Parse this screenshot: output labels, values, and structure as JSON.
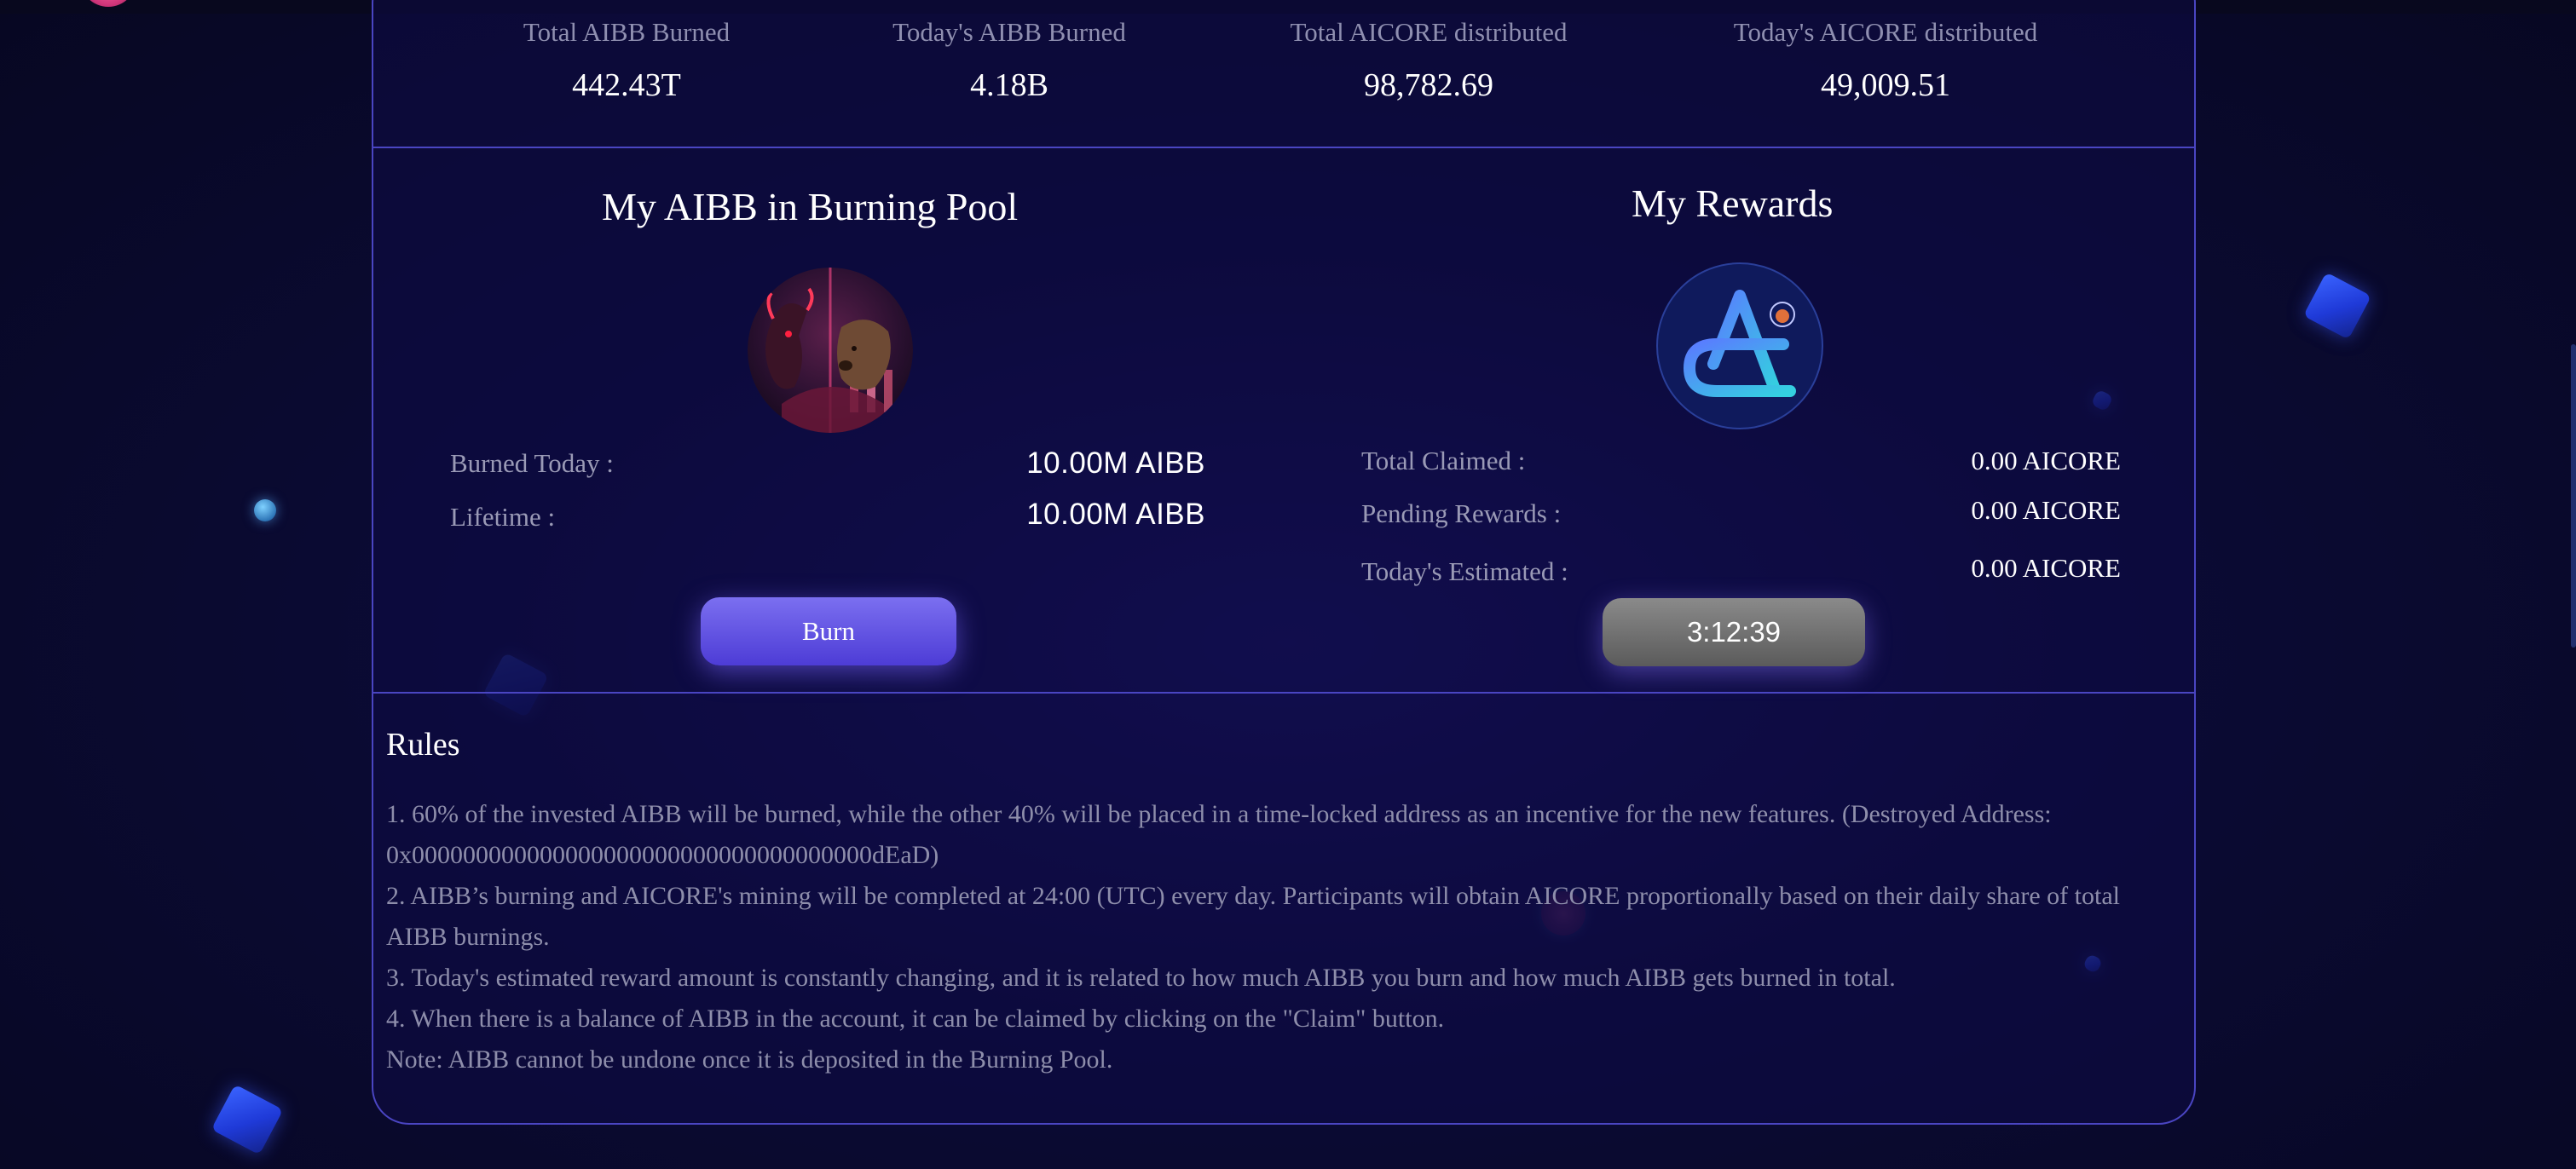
{
  "stats": [
    {
      "label": "Total AIBB Burned",
      "value": "442.43T"
    },
    {
      "label": "Today's AIBB Burned",
      "value": "4.18B"
    },
    {
      "label": "Total AICORE distributed",
      "value": "98,782.69"
    },
    {
      "label": "Today's AICORE distributed",
      "value": "49,009.51"
    }
  ],
  "pool": {
    "title": "My AIBB in Burning Pool",
    "rows": [
      {
        "label": "Burned Today :",
        "value": "10.00M AIBB"
      },
      {
        "label": "Lifetime :",
        "value": "10.00M AIBB"
      }
    ],
    "burn_label": "Burn"
  },
  "rewards": {
    "title": "My Rewards",
    "rows": [
      {
        "label": "Total Claimed :",
        "value": "0.00 AICORE"
      },
      {
        "label": "Pending Rewards :",
        "value": "0.00 AICORE"
      },
      {
        "label": "Today's Estimated :",
        "value": "0.00 AICORE"
      }
    ],
    "countdown": "3:12:39"
  },
  "rules": {
    "title": "Rules",
    "items": [
      "1. 60% of the invested AIBB will be burned, while the other 40% will be placed in a time-locked address as an incentive for the new features. (Destroyed Address: 0x000000000000000000000000000000000000dEaD)",
      "2. AIBB’s burning and AICORE's mining will be completed at 24:00 (UTC) every day. Participants will obtain AICORE proportionally based on their daily share of total AIBB burnings.",
      "3. Today's estimated reward amount is constantly changing, and it is related to how much AIBB you burn and how much AIBB gets burned in total.",
      "4. When there is a balance of AIBB in the account, it can be claimed by clicking on the \"Claim\" button.",
      "Note: AIBB cannot be undone once it is deposited in the Burning Pool."
    ]
  },
  "theme": {
    "accent": "#4d3cd6",
    "border": "#4a45c2",
    "background": "#0b0b35",
    "muted_text": "#8e8eab"
  }
}
